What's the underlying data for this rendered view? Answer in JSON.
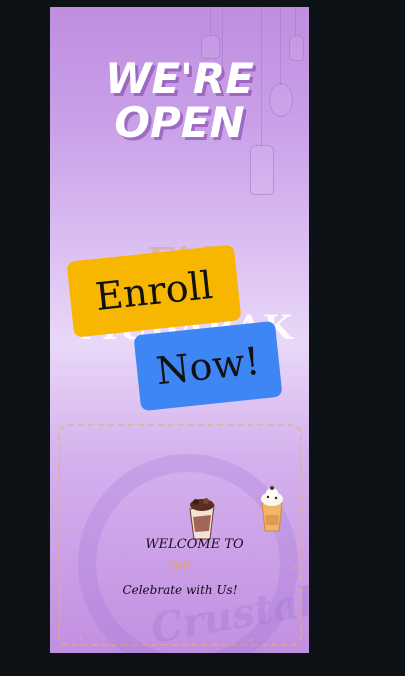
{
  "poster": {
    "headline_line1": "WE'RE",
    "headline_line2": "OPEN",
    "faint_text_top": "Eid",
    "faint_text_bottom": "MUBARAK",
    "welcome_text": "WELCOME TO",
    "you_text": "YOU",
    "celebrate_text": "Celebrate with Us!",
    "watermark_text": "Crustal"
  },
  "overlay": {
    "enroll_label": "Enroll",
    "now_label": "Now!",
    "enroll_color": "#f7b700",
    "now_color": "#3d86f3"
  },
  "colors": {
    "page_background": "#0d1216",
    "poster_top": "#bf8ee0",
    "poster_mid": "#e9d8f7",
    "gold_accent": "#e6a24a"
  },
  "icons": [
    "hanging-lantern-icon",
    "crescent-moon-icon",
    "milkshake-icon",
    "chocolate-shake-icon",
    "cafe-logo-watermark-icon"
  ]
}
